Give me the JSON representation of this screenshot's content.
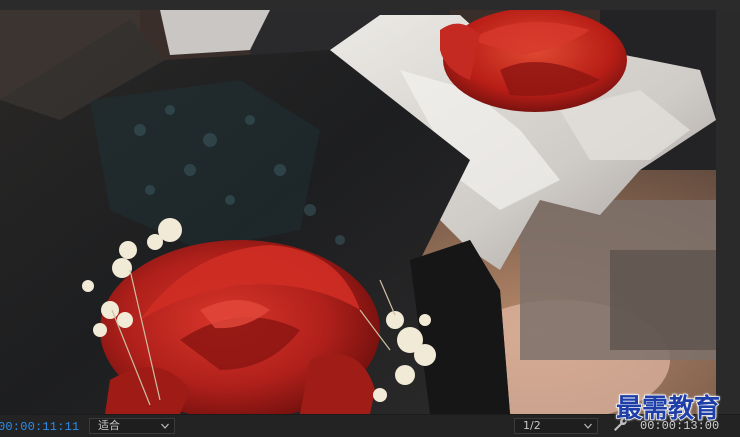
{
  "playback": {
    "current_timecode": "00:00:11:11",
    "duration_timecode": "00:00:13:00"
  },
  "zoom_dropdown": {
    "selected": "适合"
  },
  "resolution_dropdown": {
    "selected": "1/2"
  },
  "watermark": {
    "text": "最需教育"
  },
  "icons": {
    "settings": "wrench-icon",
    "dropdown": "chevron-down-icon"
  },
  "colors": {
    "current_timecode": "#2d8ceb",
    "panel_background": "#232323",
    "watermark_fill": "#1f3fa8"
  }
}
